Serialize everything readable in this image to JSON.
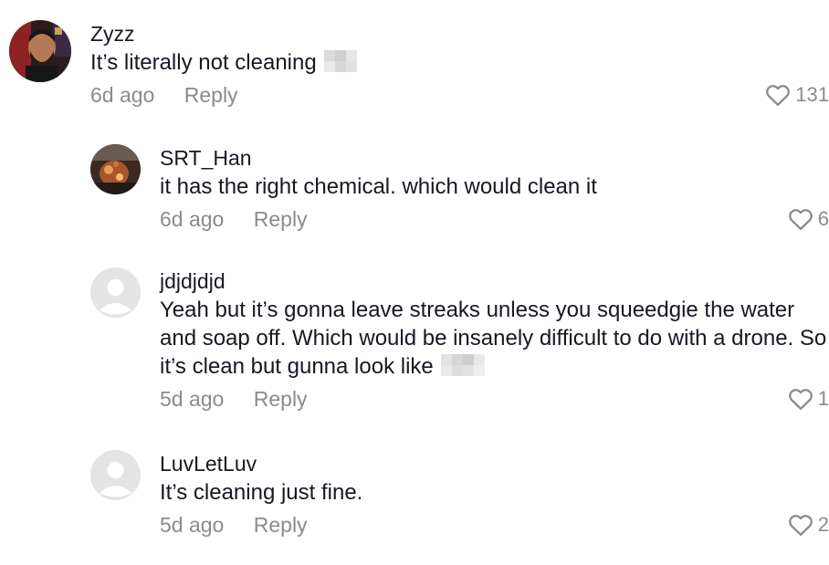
{
  "comments": [
    {
      "username": "Zyzz",
      "text": "It’s literally not cleaning",
      "has_sticker": true,
      "time": "6d ago",
      "reply_label": "Reply",
      "likes": "131"
    },
    {
      "username": "SRT_Han",
      "text": "it has the right chemical. which would clean it",
      "has_sticker": false,
      "time": "6d ago",
      "reply_label": "Reply",
      "likes": "6"
    },
    {
      "username": "jdjdjdjd",
      "text": "Yeah but it’s gonna leave streaks unless you squeedgie the water and soap off. Which would be insanely difficult to do with a drone. So it’s clean but gunna look like",
      "has_sticker": true,
      "time": "5d ago",
      "reply_label": "Reply",
      "likes": "1"
    },
    {
      "username": "LuvLetLuv",
      "text": "It’s cleaning just fine.",
      "has_sticker": false,
      "time": "5d ago",
      "reply_label": "Reply",
      "likes": "2"
    }
  ],
  "icons": {
    "like": "heart-outline-icon",
    "avatar_default": "default-user-avatar-icon",
    "sticker": "pixelated-sticker-icon"
  },
  "colors": {
    "text_primary": "#161823",
    "text_secondary": "#8a8b91",
    "avatar_placeholder_bg": "#e4e4e6"
  }
}
